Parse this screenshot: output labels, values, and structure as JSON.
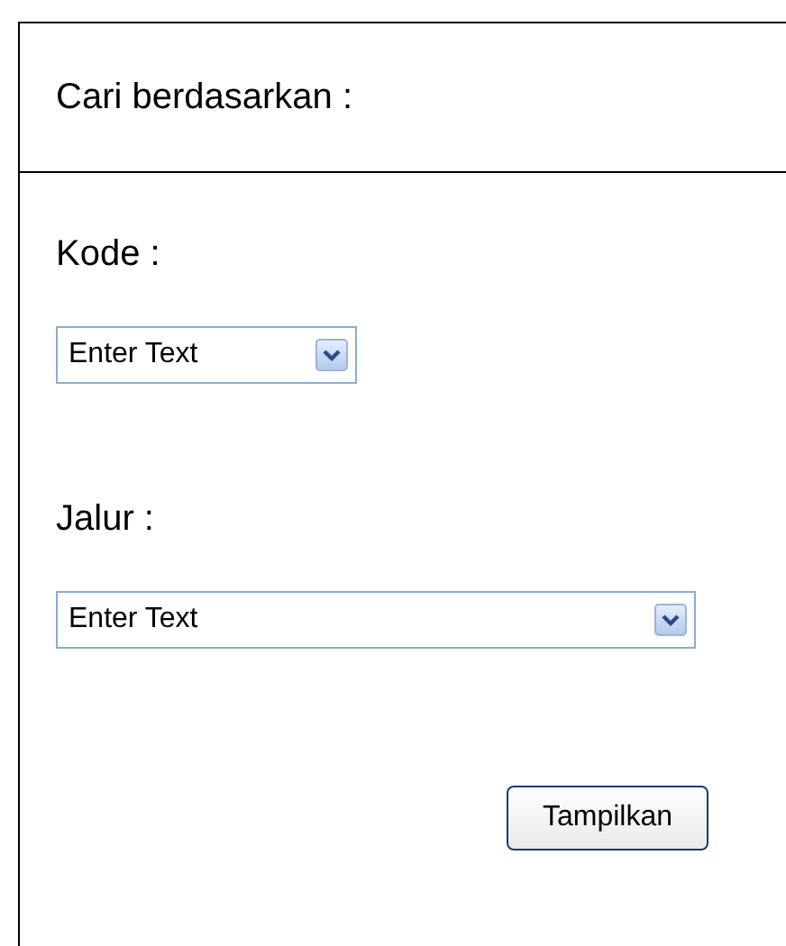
{
  "header": {
    "title": "Cari berdasarkan :"
  },
  "fields": [
    {
      "label": "Kode :",
      "placeholder": "Enter Text",
      "kind": "short"
    },
    {
      "label": "Jalur :",
      "placeholder": "Enter Text",
      "kind": "long"
    }
  ],
  "buttons": [
    "Tampilkan"
  ]
}
